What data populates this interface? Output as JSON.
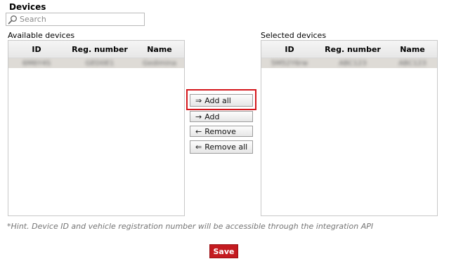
{
  "title": "Devices",
  "search": {
    "placeholder": "Search",
    "icon": "search-icon"
  },
  "available": {
    "label": "Available devices",
    "columns": [
      "ID",
      "Reg. number",
      "Name"
    ],
    "rows": [
      {
        "id": "6M6Y4S",
        "reg": "GED0E1",
        "name": "Gedimina"
      }
    ]
  },
  "selected": {
    "label": "Selected devices",
    "columns": [
      "ID",
      "Reg. number",
      "Name"
    ],
    "rows": [
      {
        "id": "5M52Y6rw",
        "reg": "ABC123",
        "name": "ABC123"
      }
    ]
  },
  "buttons": {
    "add_all": {
      "arrow": "⇒",
      "label": "Add all"
    },
    "add": {
      "arrow": "→",
      "label": "Add"
    },
    "remove": {
      "arrow": "←",
      "label": "Remove"
    },
    "remove_all": {
      "arrow": "⇐",
      "label": "Remove all"
    }
  },
  "hint": "*Hint. Device ID and vehicle registration number will be accessible through the integration API",
  "save_label": "Save",
  "colors": {
    "accent": "#c41b20",
    "highlight": "#d4171c",
    "selected_row": "#dedbd6"
  }
}
